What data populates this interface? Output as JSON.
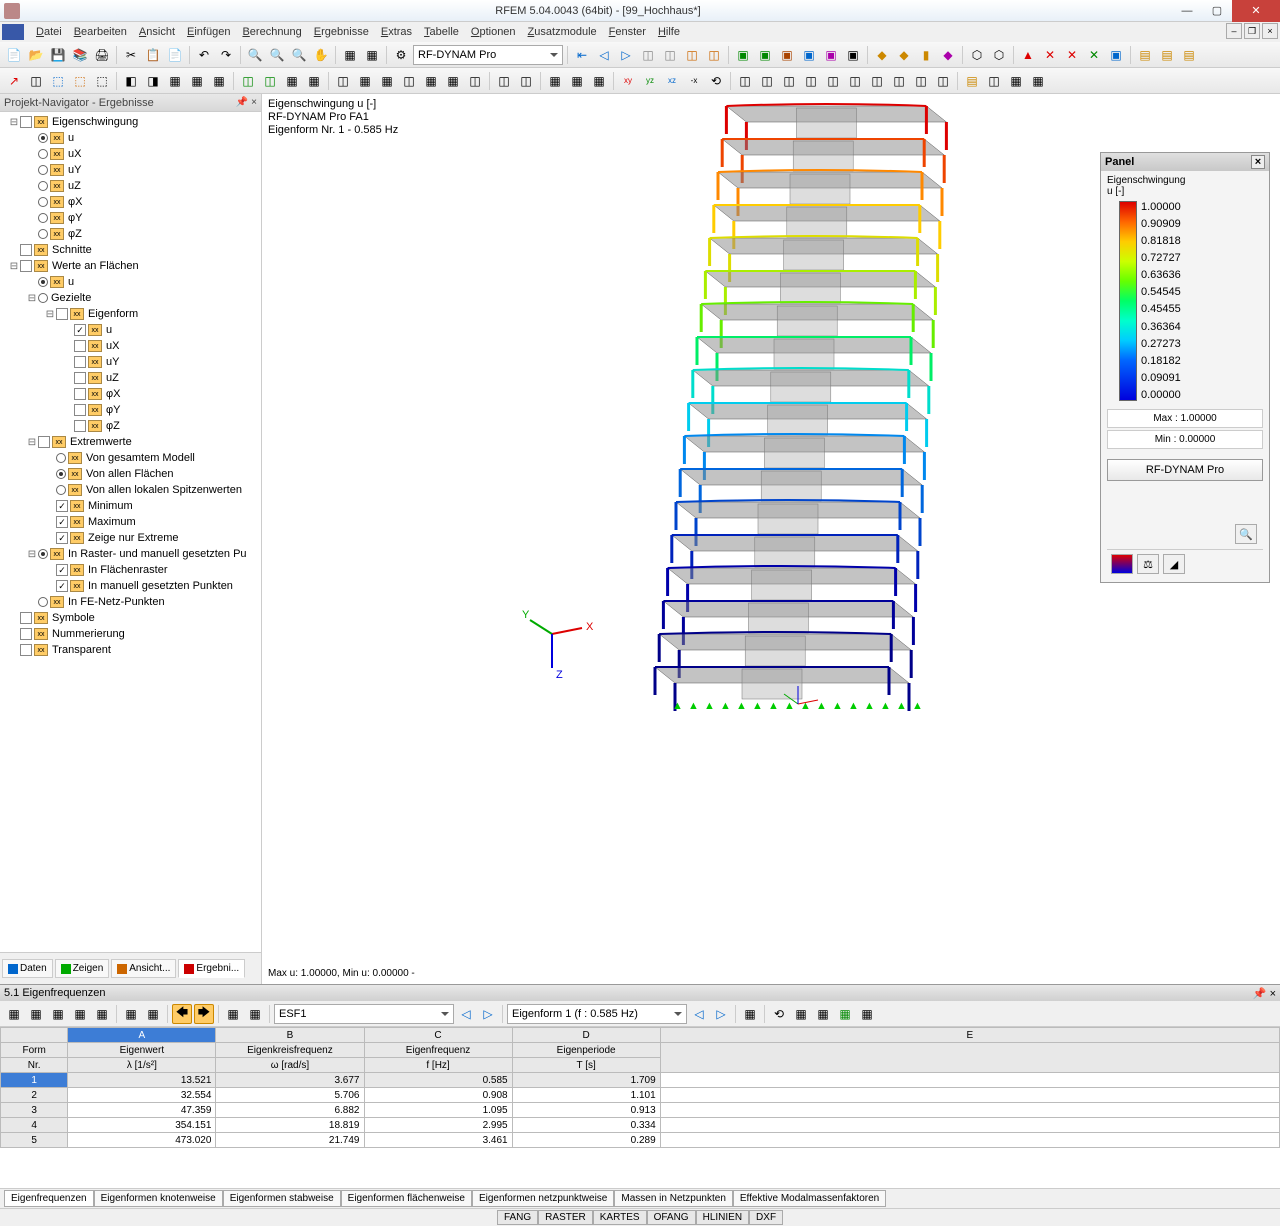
{
  "window": {
    "title": "RFEM 5.04.0043 (64bit) - [99_Hochhaus*]"
  },
  "menu": [
    "Datei",
    "Bearbeiten",
    "Ansicht",
    "Einfügen",
    "Berechnung",
    "Ergebnisse",
    "Extras",
    "Tabelle",
    "Optionen",
    "Zusatzmodule",
    "Fenster",
    "Hilfe"
  ],
  "toolbar1": {
    "dropdown": "RF-DYNAM Pro"
  },
  "navigator": {
    "title": "Projekt-Navigator - Ergebnisse",
    "tree": [
      {
        "d": 0,
        "exp": "-",
        "chk": "",
        "ico": 1,
        "lbl": "Eigenschwingung"
      },
      {
        "d": 1,
        "rad": "on",
        "ico": 1,
        "lbl": "u"
      },
      {
        "d": 1,
        "rad": "",
        "ico": 1,
        "lbl": "uX"
      },
      {
        "d": 1,
        "rad": "",
        "ico": 1,
        "lbl": "uY"
      },
      {
        "d": 1,
        "rad": "",
        "ico": 1,
        "lbl": "uZ"
      },
      {
        "d": 1,
        "rad": "",
        "ico": 1,
        "lbl": "φX"
      },
      {
        "d": 1,
        "rad": "",
        "ico": 1,
        "lbl": "φY"
      },
      {
        "d": 1,
        "rad": "",
        "ico": 1,
        "lbl": "φZ"
      },
      {
        "d": 0,
        "chk": "",
        "ico": 2,
        "lbl": "Schnitte"
      },
      {
        "d": 0,
        "exp": "-",
        "chk": "",
        "ico": 1,
        "lbl": "Werte an Flächen"
      },
      {
        "d": 1,
        "rad": "on",
        "ico": 1,
        "lbl": "u"
      },
      {
        "d": 1,
        "exp": "-",
        "rad": "",
        "lbl": "Gezielte"
      },
      {
        "d": 2,
        "exp": "-",
        "chk": "",
        "ico": 1,
        "lbl": "Eigenform"
      },
      {
        "d": 3,
        "chk": "✓",
        "ico": 1,
        "lbl": "u"
      },
      {
        "d": 3,
        "chk": "",
        "ico": 1,
        "lbl": "uX"
      },
      {
        "d": 3,
        "chk": "",
        "ico": 1,
        "lbl": "uY"
      },
      {
        "d": 3,
        "chk": "",
        "ico": 1,
        "lbl": "uZ"
      },
      {
        "d": 3,
        "chk": "",
        "ico": 1,
        "lbl": "φX"
      },
      {
        "d": 3,
        "chk": "",
        "ico": 1,
        "lbl": "φY"
      },
      {
        "d": 3,
        "chk": "",
        "ico": 1,
        "lbl": "φZ"
      },
      {
        "d": 1,
        "exp": "-",
        "chk": "",
        "ico": 1,
        "lbl": "Extremwerte"
      },
      {
        "d": 2,
        "rad": "",
        "ico": 1,
        "lbl": "Von gesamtem Modell"
      },
      {
        "d": 2,
        "rad": "on",
        "ico": 1,
        "lbl": "Von allen Flächen"
      },
      {
        "d": 2,
        "rad": "",
        "ico": 1,
        "lbl": "Von allen lokalen Spitzenwerten"
      },
      {
        "d": 2,
        "chk": "✓",
        "ico": 1,
        "lbl": "Minimum"
      },
      {
        "d": 2,
        "chk": "✓",
        "ico": 1,
        "lbl": "Maximum"
      },
      {
        "d": 2,
        "chk": "✓",
        "ico": 1,
        "lbl": "Zeige nur Extreme"
      },
      {
        "d": 1,
        "exp": "-",
        "rad": "on",
        "ico": 1,
        "lbl": "In Raster- und manuell gesetzten Pu"
      },
      {
        "d": 2,
        "chk": "✓",
        "ico": 1,
        "lbl": "In Flächenraster"
      },
      {
        "d": 2,
        "chk": "✓",
        "ico": 1,
        "lbl": "In manuell gesetzten Punkten"
      },
      {
        "d": 1,
        "rad": "",
        "ico": 1,
        "lbl": "In FE-Netz-Punkten"
      },
      {
        "d": 0,
        "chk": "",
        "ico": 1,
        "lbl": "Symbole"
      },
      {
        "d": 0,
        "chk": "",
        "ico": 1,
        "lbl": "Nummerierung"
      },
      {
        "d": 0,
        "chk": "",
        "ico": 1,
        "lbl": "Transparent"
      }
    ],
    "tabs": [
      "Daten",
      "Zeigen",
      "Ansicht...",
      "Ergebni..."
    ]
  },
  "viewport": {
    "label1": "Eigenschwingung u [-]",
    "label2": "RF-DYNAM Pro FA1",
    "label3": "Eigenform Nr. 1 - 0.585 Hz",
    "footer": "Max u: 1.00000, Min u: 0.00000 -"
  },
  "panel": {
    "title": "Panel",
    "subtitle": "Eigenschwingung",
    "unit": "u [-]",
    "scale": [
      "1.00000",
      "0.90909",
      "0.81818",
      "0.72727",
      "0.63636",
      "0.54545",
      "0.45455",
      "0.36364",
      "0.27273",
      "0.18182",
      "0.09091",
      "0.00000"
    ],
    "max": "Max  :  1.00000",
    "min": "Min   :  0.00000",
    "button": "RF-DYNAM Pro"
  },
  "results": {
    "title": "5.1 Eigenfrequenzen",
    "combo1": "ESF1",
    "combo2": "Eigenform 1 (f : 0.585 Hz)",
    "colLetters": [
      "A",
      "B",
      "C",
      "D",
      "E"
    ],
    "headers1": [
      "Form",
      "Eigenwert",
      "Eigenkreisfrequenz",
      "Eigenfrequenz",
      "Eigenperiode"
    ],
    "headers2": [
      "Nr.",
      "λ [1/s²]",
      "ω [rad/s]",
      "f [Hz]",
      "T [s]"
    ],
    "rows": [
      [
        "1",
        "13.521",
        "3.677",
        "0.585",
        "1.709"
      ],
      [
        "2",
        "32.554",
        "5.706",
        "0.908",
        "1.101"
      ],
      [
        "3",
        "47.359",
        "6.882",
        "1.095",
        "0.913"
      ],
      [
        "4",
        "354.151",
        "18.819",
        "2.995",
        "0.334"
      ],
      [
        "5",
        "473.020",
        "21.749",
        "3.461",
        "0.289"
      ]
    ],
    "tabs": [
      "Eigenfrequenzen",
      "Eigenformen knotenweise",
      "Eigenformen stabweise",
      "Eigenformen flächenweise",
      "Eigenformen netzpunktweise",
      "Massen in Netzpunkten",
      "Effektive Modalmassenfaktoren"
    ]
  },
  "statusbar": [
    "FANG",
    "RASTER",
    "KARTES",
    "OFANG",
    "HLINIEN",
    "DXF"
  ]
}
